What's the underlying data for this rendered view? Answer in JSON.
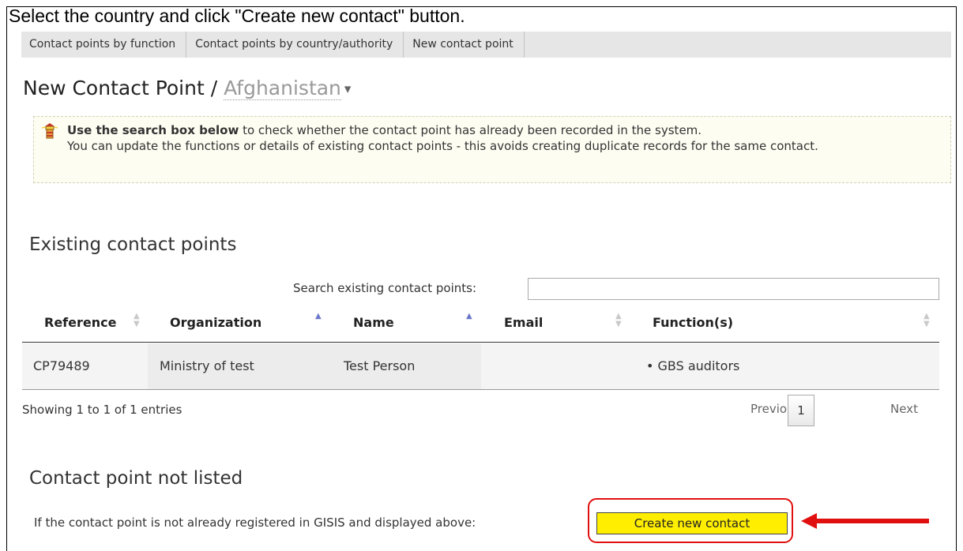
{
  "instruction": "Select the country and click \"Create new contact\" button.",
  "tabs": [
    {
      "label": "Contact points by function"
    },
    {
      "label": "Contact points by country/authority"
    },
    {
      "label": "New contact point"
    }
  ],
  "page": {
    "title_prefix": "New Contact Point / ",
    "country": "Afghanistan",
    "caret": "▾"
  },
  "info": {
    "strong": "Use the search box below",
    "rest": " to check whether the contact point has already been recorded in the system.",
    "line2": "You can update the functions or details of existing contact points - this avoids creating duplicate records for the same contact."
  },
  "existing": {
    "heading": "Existing contact points",
    "search_label": "Search existing contact points:",
    "search_value": "",
    "columns": [
      "Reference",
      "Organization",
      "Name",
      "Email",
      "Function(s)"
    ],
    "rows": [
      {
        "reference": "CP79489",
        "organization": "Ministry of test",
        "name": "Test Person",
        "email": "",
        "functions": "• GBS auditors"
      }
    ],
    "showing": "Showing 1 to 1 of 1 entries",
    "pager": {
      "previous": "Previous",
      "page": "1",
      "next": "Next"
    }
  },
  "not_listed": {
    "heading": "Contact point not listed",
    "text": "If the contact point is not already registered in GISIS and displayed above:",
    "button": "Create new contact"
  },
  "colors": {
    "highlight": "#e01010",
    "button_bg": "#ffee00",
    "tab_bg": "#e6e6e6",
    "sort_active": "#6b77c9"
  }
}
